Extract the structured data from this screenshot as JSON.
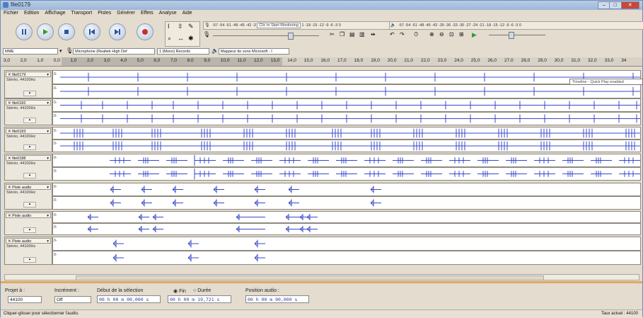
{
  "window": {
    "title": "file0179",
    "menu": [
      "Fichier",
      "Edition",
      "Affichage",
      "Transport",
      "Pistes",
      "Générer",
      "Effets",
      "Analyse",
      "Aide"
    ]
  },
  "meters": {
    "record_scale": "-57 -54 -51 -48 -45 -42 -3",
    "record_prompt": "Clic to Start Monitoring",
    "record_scale_right": "1 -18 -15 -12 -9 -6 -3 0",
    "play_scale": "-57 -54 -51 -48 -45 -42 -39 -36 -33 -30 -27 -24 -21 -18 -15 -12 -9 -6 -3 0"
  },
  "devices": {
    "host": "MME",
    "input_device": "Microphone (Realtek High Def",
    "channels": "1 (Mono) Records",
    "output_device": "Mappeur de sons Microsoft - I"
  },
  "ruler": {
    "ticks": [
      "3,0",
      "2,0",
      "1,0",
      "0,0",
      "1,0",
      "2,0",
      "3,0",
      "4,0",
      "5,0",
      "6,0",
      "7,0",
      "8,0",
      "9,0",
      "10,0",
      "11,0",
      "12,0",
      "13,0",
      "14,0",
      "15,0",
      "16,0",
      "17,0",
      "18,0",
      "19,0",
      "20,0",
      "21,0",
      "22,0",
      "23,0",
      "24,0",
      "25,0",
      "26,0",
      "27,0",
      "28,0",
      "29,0",
      "30,0",
      "31,0",
      "32,0",
      "33,0",
      "34"
    ],
    "tooltip": "Timeline - Quick Play enabled"
  },
  "tracks": [
    {
      "name": "file0179",
      "format": "Stéréo, 44100Hz"
    },
    {
      "name": "file0182",
      "format": "Stéréo, 44100Hz"
    },
    {
      "name": "file0183",
      "format": "Stéréo, 44100Hz"
    },
    {
      "name": "file0188",
      "format": "Stéréo, 44100Hz"
    },
    {
      "name": "Piste audio",
      "format": "Stéréo, 44100Hz"
    },
    {
      "name": "Piste audio",
      "format": ""
    },
    {
      "name": "Piste audio",
      "format": "Stéréo, 44100Hz"
    }
  ],
  "selection_toolbar": {
    "project_rate_label": "Projet à :",
    "project_rate_value": "44100",
    "snap_label": "Incrément :",
    "snap_value": "Off",
    "start_label": "Début de la sélection",
    "end_label": "Fin",
    "length_label": "Durée",
    "position_label": "Position audio :",
    "start_value": "00 h 00 m 00,000 s",
    "end_value": "00 h 00 m 19,721 s",
    "position_value": "00 h 00 m 00,000 s"
  },
  "status": {
    "message": "Cliquer-glisser pour sélectionner l'audio.",
    "rate": "Taux actuel : 44100"
  },
  "colors": {
    "wave": "#3848c8",
    "accent": "#e3a75c"
  }
}
